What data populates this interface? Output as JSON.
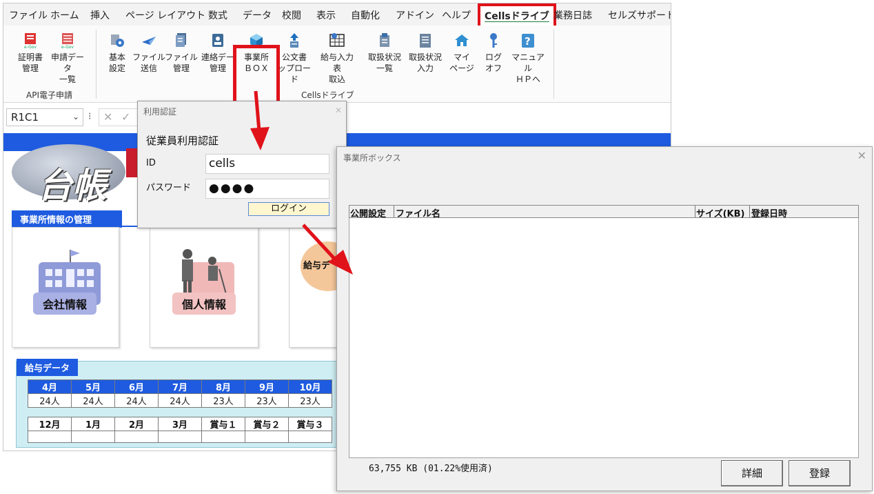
{
  "menu": {
    "items": [
      "ファイル",
      "ホーム",
      "挿入",
      "ページ レイアウト",
      "数式",
      "データ",
      "校閲",
      "表示",
      "自動化",
      "アドイン",
      "ヘルプ",
      "Cellsドライブ",
      "業務日誌",
      "セルズサポート"
    ]
  },
  "ribbon": {
    "api_group": {
      "label": "API電子申請",
      "buttons": [
        {
          "line1": "証明書",
          "line2": "管理",
          "icon": "certificate-icon"
        },
        {
          "line1": "申請データ",
          "line2": "一覧",
          "icon": "application-list-icon"
        }
      ]
    },
    "cells_group": {
      "label": "Cellsドライブ",
      "buttons": [
        {
          "line1": "基本",
          "line2": "設定",
          "icon": "settings-gear-icon"
        },
        {
          "line1": "ファイル",
          "line2": "送信",
          "icon": "send-icon"
        },
        {
          "line1": "ファイル",
          "line2": "管理",
          "icon": "file-icon"
        },
        {
          "line1": "連絡デー",
          "line2": "管理",
          "icon": "contact-icon"
        },
        {
          "line1": "事業所",
          "line2": "ＢＯＸ",
          "icon": "cube-box-icon"
        },
        {
          "line1": "公文書",
          "line2": "ップロード",
          "icon": "upload-icon"
        },
        {
          "line1": "給与入力表",
          "line2": "取込",
          "icon": "import-grid-icon"
        },
        {
          "line1": "取扱状況",
          "line2": "一覧",
          "icon": "status-list-icon"
        },
        {
          "line1": "取扱状況",
          "line2": "入力",
          "icon": "status-input-icon"
        },
        {
          "line1": "マイ",
          "line2": "ページ",
          "icon": "home-icon"
        },
        {
          "line1": "ログ",
          "line2": "オフ",
          "icon": "key-icon"
        },
        {
          "line1": "マニュアル",
          "line2": "ＨＰへ",
          "icon": "help-icon"
        }
      ]
    }
  },
  "formula_bar": {
    "cell_ref": "R1C1",
    "cancel_glyph": "✕",
    "enter_glyph": "✓"
  },
  "sheet": {
    "logo_text": "台帳",
    "section_title": "事業所情報の管理",
    "cards": [
      {
        "label": "会社情報",
        "icon": "company-building-icon"
      },
      {
        "label": "個人情報",
        "icon": "person-icon"
      },
      {
        "label": "給与デ",
        "icon": "salary-icon"
      }
    ],
    "salary": {
      "title": "給与データ",
      "row1_headers": [
        "4月",
        "5月",
        "6月",
        "7月",
        "8月",
        "9月",
        "10月"
      ],
      "row1_values": [
        "24人",
        "24人",
        "24人",
        "24人",
        "23人",
        "23人",
        "23人"
      ],
      "row2_headers": [
        "12月",
        "1月",
        "2月",
        "3月",
        "賞与１",
        "賞与２",
        "賞与３"
      ]
    }
  },
  "auth_dialog": {
    "title": "利用認証",
    "heading": "従業員利用認証",
    "id_label": "ID",
    "id_value": "cells",
    "password_label": "パスワード",
    "password_value": "●●●●",
    "login_label": "ログイン"
  },
  "office_box_dialog": {
    "title": "事業所ボックス",
    "columns": [
      "公開設定",
      "ファイル名",
      "サイズ(KB)",
      "登録日時"
    ],
    "rows": [],
    "usage_text": "63,755 KB (01.22%使用済)",
    "detail_label": "詳細",
    "register_label": "登録"
  },
  "colors": {
    "highlight": "#e0121a",
    "sheet_blue": "#1e5be0",
    "salary_bg": "#cfeef4"
  }
}
